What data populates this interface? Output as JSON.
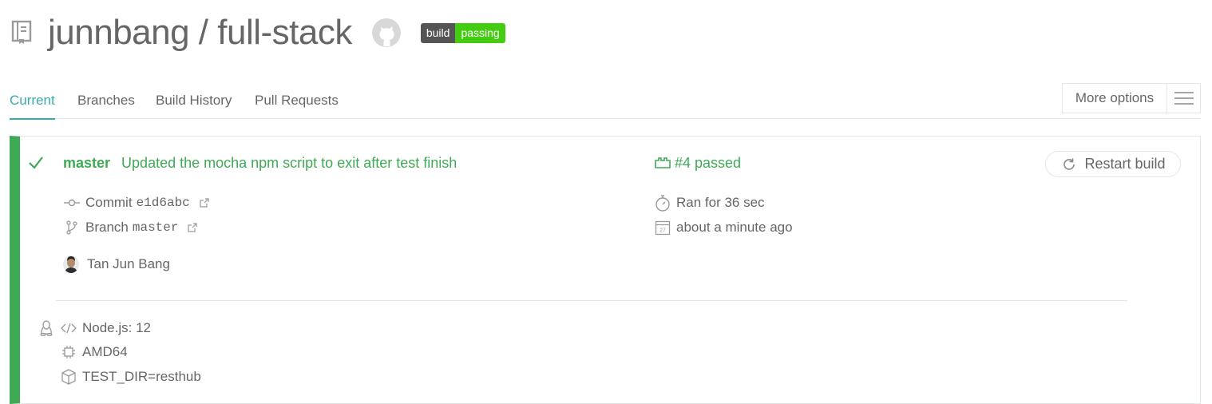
{
  "repo": {
    "owner": "junnbang",
    "separator": "/",
    "name": "full-stack",
    "title": "junnbang / full-stack",
    "badge_left": "build",
    "badge_right": "passing"
  },
  "tabs": [
    {
      "label": "Current",
      "active": true
    },
    {
      "label": "Branches",
      "active": false
    },
    {
      "label": "Build History",
      "active": false
    },
    {
      "label": "Pull Requests",
      "active": false
    }
  ],
  "more_options": {
    "label": "More options",
    "icon": "hamburger-icon"
  },
  "build": {
    "branch": "master",
    "message": "Updated the mocha npm script to exit after test finish",
    "status": "#4 passed",
    "restart_label": "Restart build",
    "commit_label": "Commit",
    "commit_sha": "e1d6abc",
    "branch_label": "Branch",
    "branch_name": "master",
    "duration": "Ran for 36 sec",
    "finished": "about a minute ago",
    "author": "Tan Jun Bang",
    "language": "Node.js: 12",
    "arch": "AMD64",
    "env": "TEST_DIR=resthub"
  },
  "colors": {
    "passed": "#3eaa56",
    "accent": "#39aaaa",
    "badge_green": "#44cc11",
    "text": "#666666"
  }
}
